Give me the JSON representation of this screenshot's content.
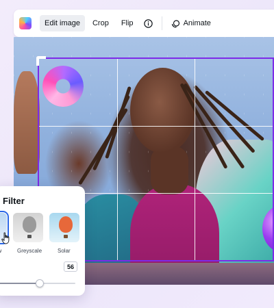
{
  "toolbar": {
    "logo_icon": "app-logo-icon",
    "edit_image_label": "Edit image",
    "crop_label": "Crop",
    "flip_label": "Flip",
    "info_icon": "info-icon",
    "animate_label": "Animate",
    "animate_icon": "animate-icon"
  },
  "filter_panel": {
    "title": "Filter",
    "filters": [
      {
        "label": "ew",
        "selected": true,
        "balloon_color": "#e94a9a",
        "basket_color": "#6a4a2a"
      },
      {
        "label": "Greyscale",
        "selected": false,
        "balloon_color": "#9a9a9a",
        "basket_color": "#555555"
      },
      {
        "label": "Solar",
        "selected": false,
        "balloon_color": "#e7683a",
        "basket_color": "#7a5230"
      }
    ],
    "intensity": {
      "value": "56",
      "fraction": 0.56
    }
  },
  "colors": {
    "accent": "#7d2ae8",
    "selection": "#2a67e8"
  }
}
